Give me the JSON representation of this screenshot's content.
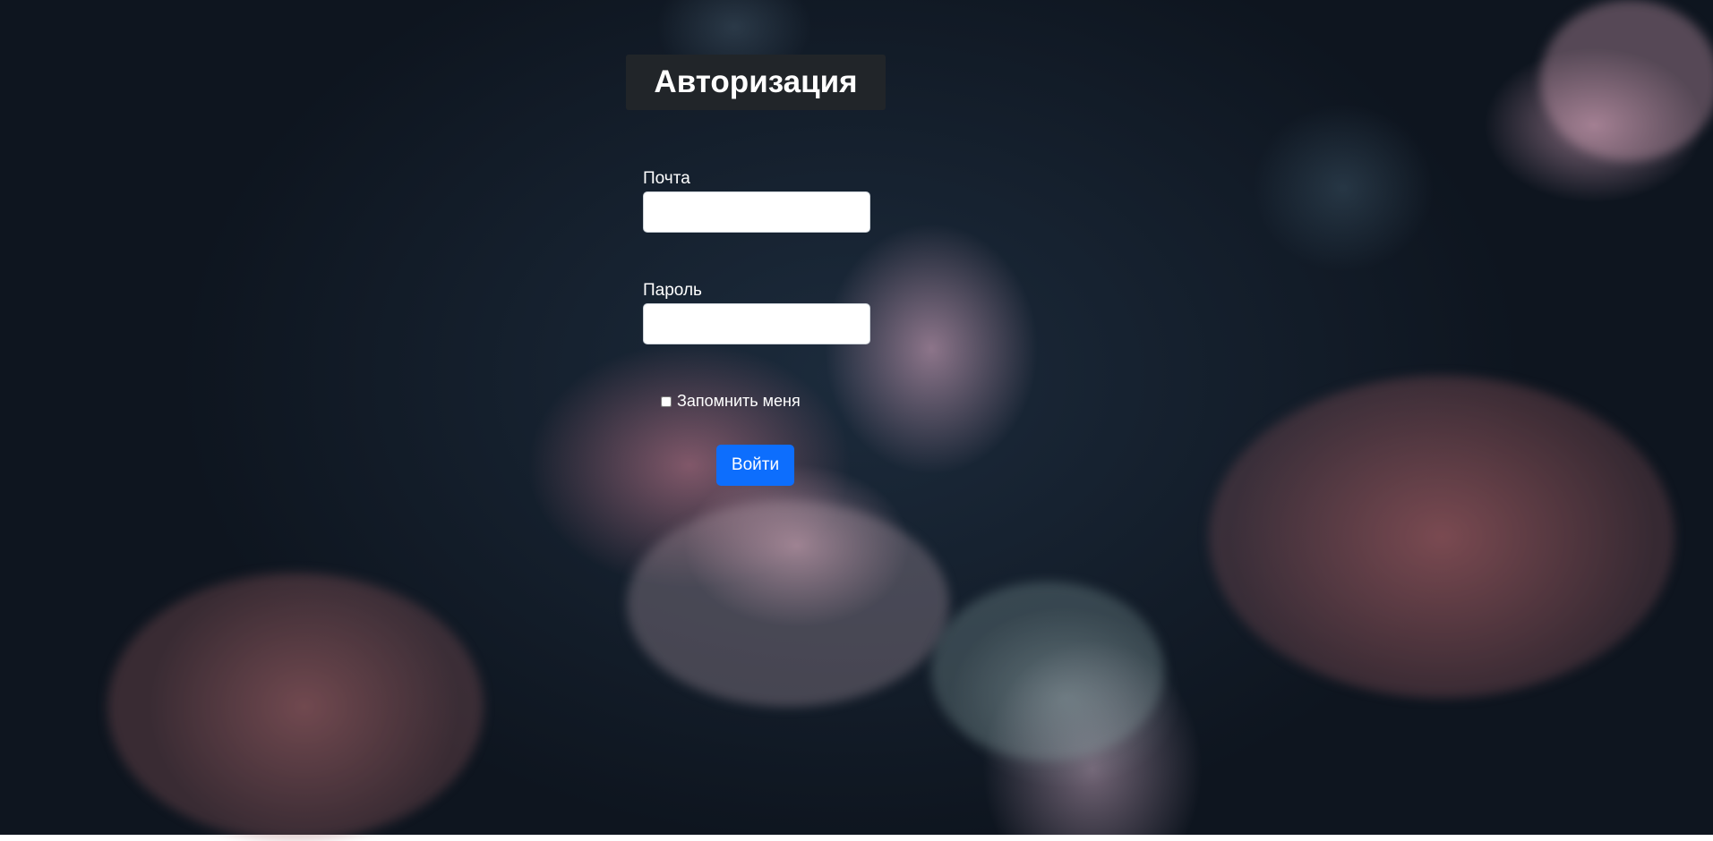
{
  "page": {
    "title": "Авторизация"
  },
  "form": {
    "email_label": "Почта",
    "email_value": "",
    "password_label": "Пароль",
    "password_value": "",
    "remember_label": "Запомнить меня",
    "remember_checked": false,
    "submit_label": "Войти"
  },
  "colors": {
    "title_bg": "#212529",
    "button_bg": "#0d6efd",
    "text": "#ffffff"
  }
}
